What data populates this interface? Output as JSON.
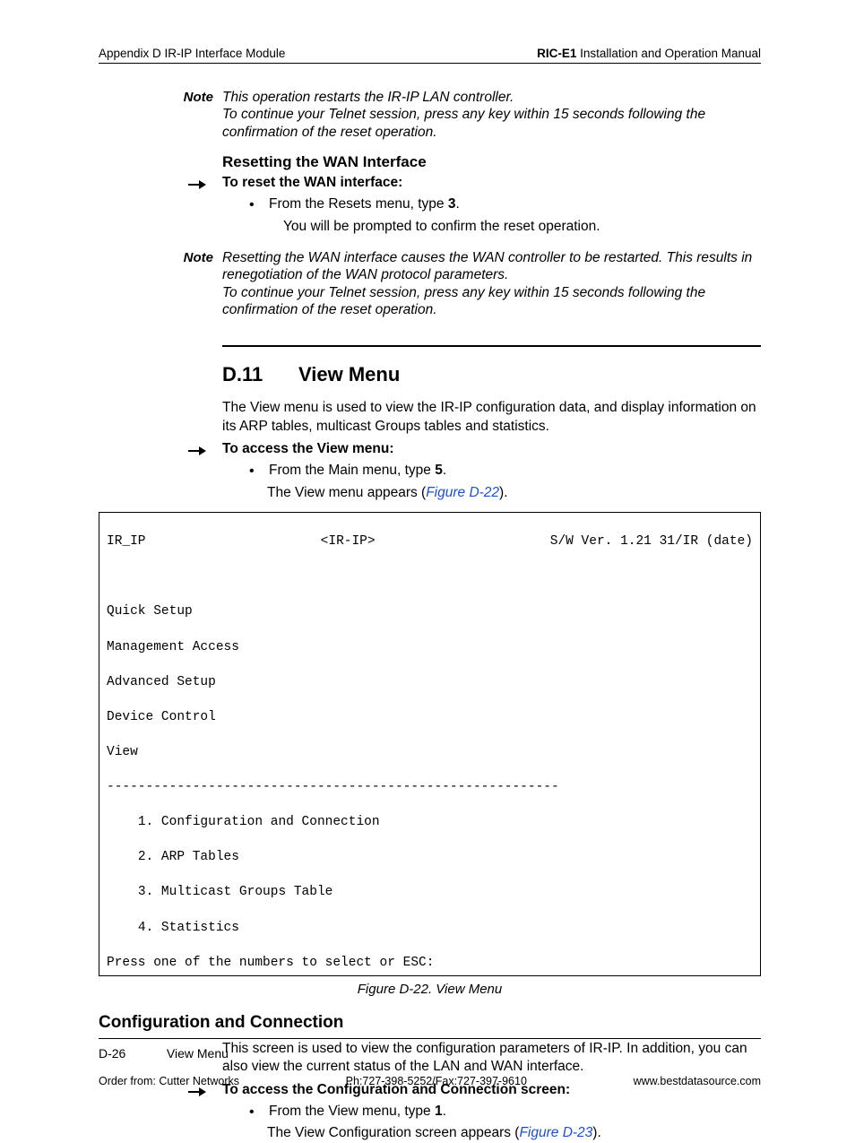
{
  "header": {
    "left": "Appendix D  IR-IP Interface Module",
    "right_bold": "RIC-E1",
    "right_rest": " Installation and Operation Manual"
  },
  "note1": {
    "label": "Note",
    "body": "This operation restarts the IR-IP LAN controller.\nTo continue your Telnet session, press any key within 15 seconds following the confirmation of the reset operation."
  },
  "reset_wan": {
    "heading": "Resetting the WAN Interface",
    "proc": "To reset the WAN interface:",
    "bullet_pre": "From the Resets menu, type ",
    "bullet_bold": "3",
    "bullet_post": ".",
    "sub": "You will be prompted to confirm the reset operation."
  },
  "note2": {
    "label": "Note",
    "body": "Resetting the WAN interface causes the WAN controller to be restarted. This results in renegotiation of the WAN protocol parameters.\nTo continue your Telnet session, press any key within 15 seconds following the confirmation of the reset operation."
  },
  "section": {
    "num": "D.11",
    "title": "View Menu",
    "intro": "The View menu is used to view the IR-IP configuration data, and display information on its ARP tables, multicast Groups tables and statistics.",
    "proc": "To access the View menu:",
    "bullet_pre": "From the Main menu, type ",
    "bullet_bold": "5",
    "bullet_post": ".",
    "sub_pre": "The View menu appears (",
    "sub_link": "Figure D-22",
    "sub_post": ")."
  },
  "terminal": {
    "left": "IR_IP",
    "center": "<IR-IP>",
    "right": "S/W Ver. 1.21 31/IR (date)",
    "lines_top": [
      "Quick Setup",
      "Management Access",
      "Advanced Setup",
      "Device Control",
      "View"
    ],
    "dashes": "----------------------------------------------------------",
    "items": [
      "1. Configuration and Connection",
      "2. ARP Tables",
      "3. Multicast Groups Table",
      "4. Statistics"
    ],
    "prompt": "Press one of the numbers to select or ESC:"
  },
  "figcaption": "Figure D-22.  View Menu",
  "config": {
    "heading": "Configuration and Connection",
    "para": "This screen is used to view the configuration parameters of IR-IP. In addition, you can also view the current status of the LAN and WAN interface.",
    "proc": "To access the Configuration and Connection screen:",
    "bullet_pre": "From the View menu, type ",
    "bullet_bold": "1",
    "bullet_post": ".",
    "sub_pre": "The View Configuration screen appears (",
    "sub_link": "Figure D-23",
    "sub_post": ")."
  },
  "footer": {
    "page": "D-26",
    "section": "View Menu",
    "order": "Order from: Cutter Networks",
    "phone": "Ph:727-398-5252/Fax:727-397-9610",
    "url": "www.bestdatasource.com"
  }
}
